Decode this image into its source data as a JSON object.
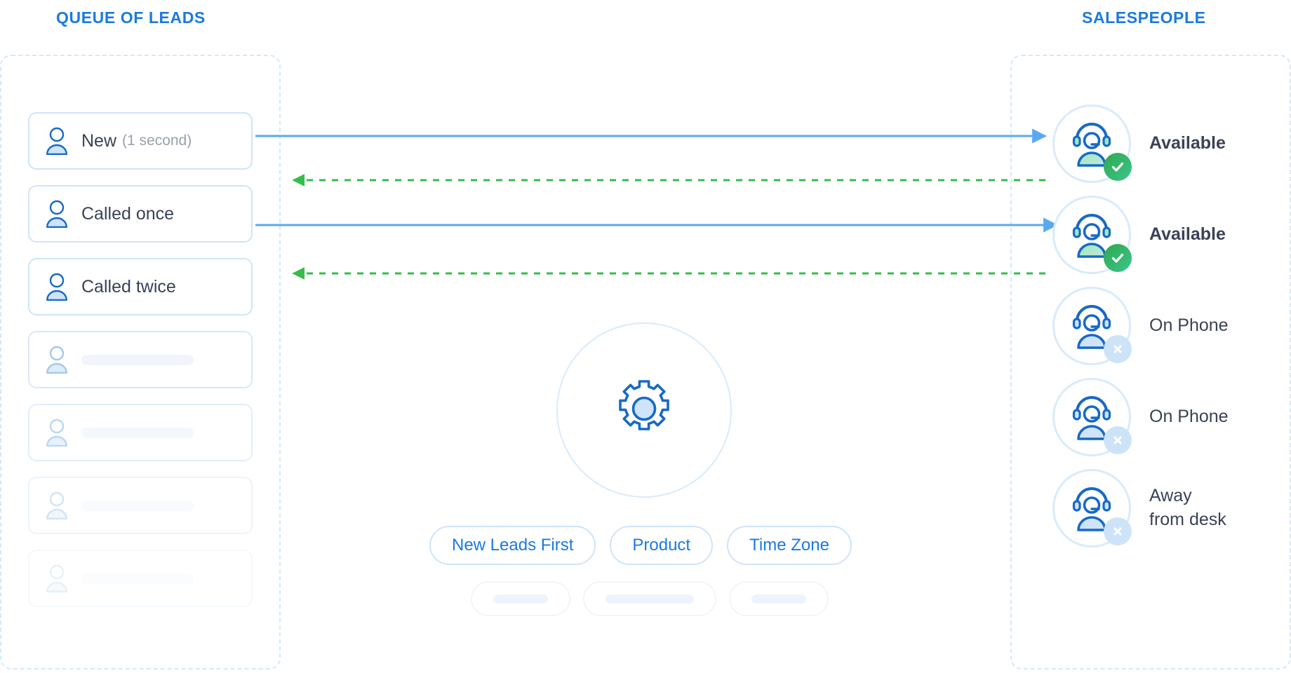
{
  "headings": {
    "queue": "QUEUE OF LEADS",
    "salespeople": "SALESPEOPLE"
  },
  "colors": {
    "accent_blue": "#1b7ae0",
    "flow_blue": "#5aa9f0",
    "return_green": "#35bd4b",
    "badge_green": "#2fa84f",
    "badge_blue": "#cde4f8",
    "card_border": "#cfe4fa",
    "dashed_border": "#d5e8fb",
    "text_dark": "#3b4256",
    "text_muted": "#9aa0ac",
    "ghost_fill": "#eef4fb"
  },
  "queue": {
    "leads": [
      {
        "label": "New",
        "sub": "(1 second)",
        "placeholder": false,
        "fade": 0
      },
      {
        "label": "Called once",
        "sub": "",
        "placeholder": false,
        "fade": 0
      },
      {
        "label": "Called twice",
        "sub": "",
        "placeholder": false,
        "fade": 0
      },
      {
        "label": "",
        "sub": "",
        "placeholder": true,
        "fade": 1
      },
      {
        "label": "",
        "sub": "",
        "placeholder": true,
        "fade": 2
      },
      {
        "label": "",
        "sub": "",
        "placeholder": true,
        "fade": 3
      },
      {
        "label": "",
        "sub": "",
        "placeholder": true,
        "fade": 4
      }
    ]
  },
  "salespeople": {
    "agents": [
      {
        "status": "Available",
        "state": "available",
        "badge": "check-icon",
        "emphasis": "bold",
        "lines": [
          "Available"
        ]
      },
      {
        "status": "Available",
        "state": "available",
        "badge": "check-icon",
        "emphasis": "bold",
        "lines": [
          "Available"
        ]
      },
      {
        "status": "On Phone",
        "state": "busy",
        "badge": "close-icon",
        "emphasis": "regular",
        "lines": [
          "On Phone"
        ]
      },
      {
        "status": "On Phone",
        "state": "busy",
        "badge": "close-icon",
        "emphasis": "regular",
        "lines": [
          "On Phone"
        ]
      },
      {
        "status": "Away from desk",
        "state": "away",
        "badge": "close-icon",
        "emphasis": "regular",
        "lines": [
          "Away",
          "from desk"
        ]
      }
    ]
  },
  "router": {
    "icon": "gear-icon",
    "rules": [
      {
        "label": "New Leads First"
      },
      {
        "label": "Product"
      },
      {
        "label": "Time Zone"
      }
    ],
    "ghost_rules": [
      {
        "width": "gp-1"
      },
      {
        "width": "gp-2"
      },
      {
        "width": "gp-3"
      }
    ]
  },
  "flows": {
    "assignments": [
      {
        "from_lead": 0,
        "to_agent": 0,
        "kind": "assign"
      },
      {
        "from_lead": 1,
        "to_agent": 1,
        "kind": "assign"
      }
    ],
    "returns": [
      {
        "from_agent": 0,
        "to_lead": 1,
        "kind": "return"
      },
      {
        "from_agent": 1,
        "to_lead": 2,
        "kind": "return"
      }
    ]
  }
}
